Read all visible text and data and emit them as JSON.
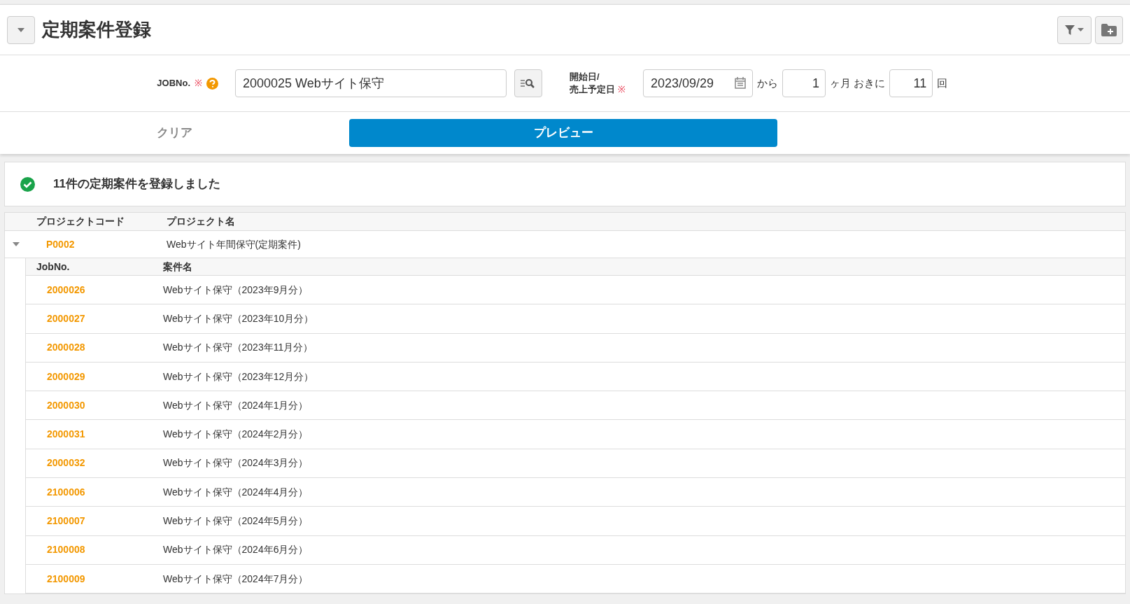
{
  "header": {
    "title": "定期案件登録",
    "collapsed": false
  },
  "form": {
    "job_label": "JOBNo.",
    "required_mark": "※",
    "job_value": "2000025 Webサイト保守",
    "date_label_1": "開始日/",
    "date_label_2": "売上予定日",
    "date_required_mark": "※",
    "date_value": "2023/09/29",
    "from_text": "から",
    "interval_value": "1",
    "interval_unit": "ヶ月 おきに",
    "count_value": "11",
    "count_unit": "回"
  },
  "actions": {
    "clear": "クリア",
    "preview": "プレビュー"
  },
  "message": "11件の定期案件を登録しました",
  "table": {
    "columns": [
      "プロジェクトコード",
      "プロジェクト名"
    ],
    "projects": [
      {
        "code": "P0002",
        "name": "Webサイト年間保守(定期案件)",
        "expanded": true,
        "sub_columns": [
          "JobNo.",
          "案件名"
        ],
        "jobs": [
          {
            "no": "2000026",
            "name": "Webサイト保守（2023年9月分）"
          },
          {
            "no": "2000027",
            "name": "Webサイト保守（2023年10月分）"
          },
          {
            "no": "2000028",
            "name": "Webサイト保守（2023年11月分）"
          },
          {
            "no": "2000029",
            "name": "Webサイト保守（2023年12月分）"
          },
          {
            "no": "2000030",
            "name": "Webサイト保守（2024年1月分）"
          },
          {
            "no": "2000031",
            "name": "Webサイト保守（2024年2月分）"
          },
          {
            "no": "2000032",
            "name": "Webサイト保守（2024年3月分）"
          },
          {
            "no": "2100006",
            "name": "Webサイト保守（2024年4月分）"
          },
          {
            "no": "2100007",
            "name": "Webサイト保守（2024年5月分）"
          },
          {
            "no": "2100008",
            "name": "Webサイト保守（2024年6月分）"
          },
          {
            "no": "2100009",
            "name": "Webサイト保守（2024年7月分）"
          }
        ]
      }
    ]
  }
}
